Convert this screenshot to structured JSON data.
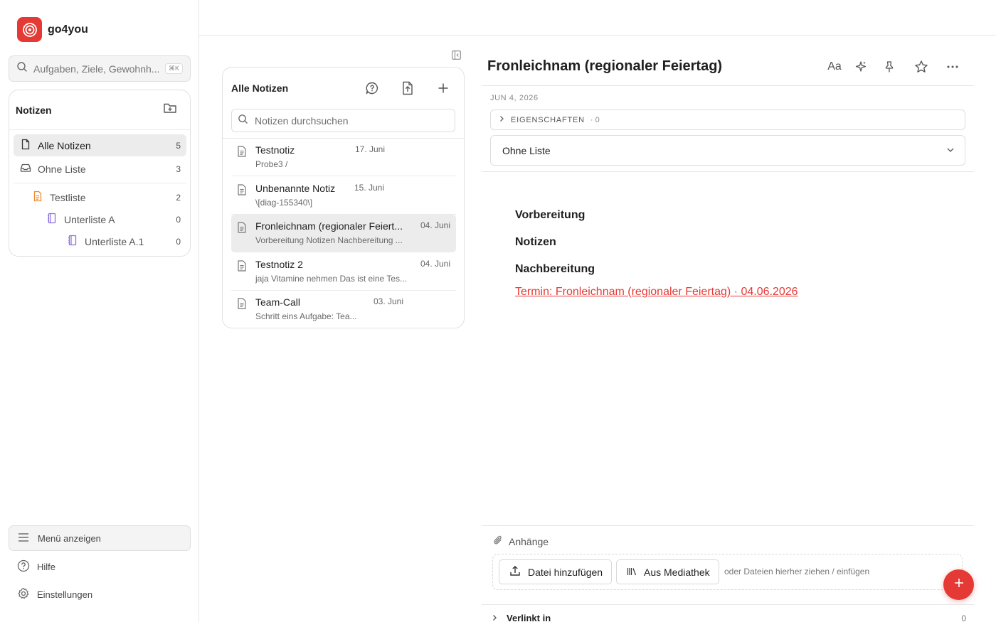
{
  "app": {
    "name": "go4you",
    "accent_color": "#e53935"
  },
  "global_search": {
    "placeholder": "Aufgaben, Ziele, Gewohnh...",
    "shortcut": "⌘K"
  },
  "notes_nav": {
    "title": "Notizen",
    "items": [
      {
        "label": "Alle Notizen",
        "count": "5",
        "icon": "file-icon"
      },
      {
        "label": "Ohne Liste",
        "count": "3",
        "icon": "inbox-icon"
      },
      {
        "label": "Testliste",
        "count": "2",
        "icon": "list-document-icon"
      },
      {
        "label": "Unterliste A",
        "count": "0",
        "icon": "notebook-icon"
      },
      {
        "label": "Unterliste A.1",
        "count": "0",
        "icon": "notebook-icon"
      }
    ]
  },
  "sidebar_footer": {
    "menu_label": "Menü anzeigen",
    "help_label": "Hilfe",
    "settings_label": "Einstellungen"
  },
  "notes_list": {
    "title": "Alle Notizen",
    "search_placeholder": "Notizen durchsuchen",
    "notes": [
      {
        "title": "Testnotiz",
        "snippet": "Probe3 /",
        "date": "17. Juni"
      },
      {
        "title": "Unbenannte Notiz",
        "snippet": "\\[diag-155340\\]",
        "date": "15. Juni"
      },
      {
        "title": "Fronleichnam (regionaler Feiert...",
        "snippet": "Vorbereitung Notizen Nachbereitung ...",
        "date": "04. Juni"
      },
      {
        "title": "Testnotiz 2",
        "snippet": "jaja Vitamine nehmen Das ist eine Tes...",
        "date": "04. Juni"
      },
      {
        "title": "Team-Call",
        "snippet": "Schritt eins Aufgabe: Tea...",
        "date": "03. Juni"
      }
    ]
  },
  "detail": {
    "title": "Fronleichnam (regionaler Feiertag)",
    "font_button": "Aa",
    "date": "JUN 4, 2026",
    "properties_label": "EIGENSCHAFTEN",
    "properties_count": "· 0",
    "list_value": "Ohne Liste",
    "headings": [
      "Vorbereitung",
      "Notizen",
      "Nachbereitung"
    ],
    "link_text": "Termin: Fronleichnam (regionaler Feiertag) · 04.06.2026",
    "attachments_label": "Anhänge",
    "add_file_label": "Datei hinzufügen",
    "media_label": "Aus Mediathek",
    "drop_hint": "oder Dateien hierher ziehen / einfügen",
    "linked_label": "Verlinkt in",
    "linked_count": "0"
  }
}
